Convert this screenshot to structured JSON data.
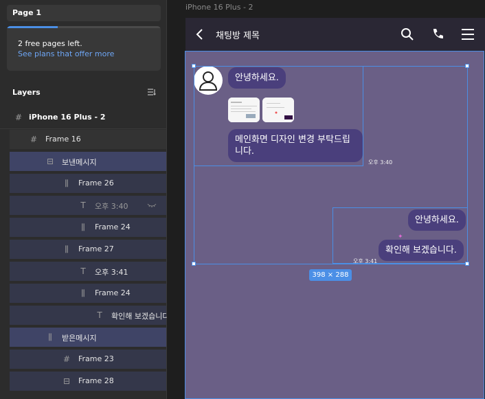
{
  "sidebar": {
    "page_label": "Page 1",
    "plan": {
      "progress": 0.33,
      "pages_left": "2 free pages left.",
      "link": "See plans that offer more"
    },
    "layers_heading": "Layers",
    "layers": [
      {
        "label": "iPhone 16 Plus - 2",
        "icon": "frame-icon"
      },
      {
        "label": "Frame 16",
        "icon": "frame-icon"
      },
      {
        "label": "보낸메시지",
        "icon": "auto-layout-vertical-icon"
      },
      {
        "label": "Frame 26",
        "icon": "auto-layout-horizontal-icon"
      },
      {
        "label": "오후 3:40",
        "icon": "text-icon"
      },
      {
        "label": "Frame 24",
        "icon": "auto-layout-horizontal-icon"
      },
      {
        "label": "Frame 27",
        "icon": "auto-layout-horizontal-icon"
      },
      {
        "label": "오후 3:41",
        "icon": "text-icon"
      },
      {
        "label": "Frame 24",
        "icon": "auto-layout-horizontal-icon"
      },
      {
        "label": "확인해 보겠습니다",
        "icon": "text-icon"
      },
      {
        "label": "받은메시지",
        "icon": "auto-layout-horizontal-icon"
      },
      {
        "label": "Frame 23",
        "icon": "frame-icon"
      },
      {
        "label": "Frame 28",
        "icon": "auto-layout-vertical-icon"
      }
    ]
  },
  "canvas": {
    "frame_title": "iPhone 16 Plus - 2",
    "header": {
      "title": "채팅방 제목"
    },
    "messages": {
      "received": [
        {
          "text": "안녕하세요."
        },
        {
          "text": "메인화면 디자인 변경 부탁드립니다."
        }
      ],
      "received_time": "오후 3:40",
      "sent": [
        {
          "text": "안녕하세요."
        },
        {
          "text": "확인해 보겠습니다."
        }
      ],
      "sent_time": "오후 3:41"
    },
    "selection_size": "398 × 288"
  },
  "colors": {
    "accent": "#4b8fe6",
    "chat_bg": "#6a5f86",
    "bubble": "#4a3f7c",
    "header_bg": "#2a2734"
  }
}
